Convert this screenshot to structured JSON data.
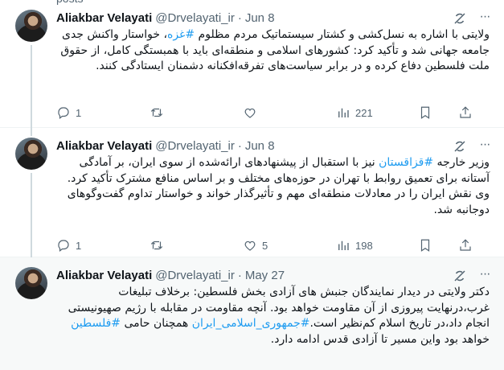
{
  "top_fragment": "posts",
  "tweets": [
    {
      "name": "Aliakbar Velayati",
      "handle": "@Drvelayati_ir",
      "dot": "·",
      "date": "Jun 8",
      "text_parts": [
        "ولایتی با اشاره به نسل‌کشی و کشتار سیستماتیک مردم مظلوم ",
        "#غزه",
        "، خواستار واکنش جدی جامعه جهانی شد و تأکید کرد: کشورهای اسلامی و منطقه‌ای باید با همبستگی کامل، از حقوق ملت فلسطین دفاع کرده و در برابر سیاست‌های تفرقه‌افکنانه دشمنان ایستادگی کنند."
      ],
      "replies": "1",
      "retweets": "",
      "likes": "",
      "views": "221"
    },
    {
      "name": "Aliakbar Velayati",
      "handle": "@Drvelayati_ir",
      "dot": "·",
      "date": "Jun 8",
      "text_parts": [
        "وزیر خارجه ",
        "#قزاقستان",
        " نیز با استقبال از پیشنهادهای ارائه‌شده از سوی ایران، بر آمادگی آستانه برای تعمیق روابط با تهران در حوزه‌های مختلف و بر اساس منافع مشترک تأکید کرد. وی نقش ایران را در معادلات منطقه‌ای مهم و تأثیرگذار خواند و خواستار تداوم گفت‌وگوهای دوجانبه شد."
      ],
      "replies": "1",
      "retweets": "",
      "likes": "5",
      "views": "198"
    },
    {
      "name": "Aliakbar Velayati",
      "handle": "@Drvelayati_ir",
      "dot": "·",
      "date": "May 27",
      "text_parts": [
        "دکتر ولایتی در دیدار نمایندگان جنبش های آزادی بخش فلسطین: برخلاف تبلیغات غرب،درنهایت پیروزی از آن مقاومت خواهد بود. آنچه مقاومت در مقابله با رژیم صهیونیستی انجام داد،در تاریخ اسلام کم‌نظیر است.",
        "#جمهوری_اسلامی_ایران",
        " همچنان حامی ",
        "#فلسطین",
        " خواهد بود واین مسیر تا آزادی قدس ادامه دارد."
      ]
    }
  ],
  "icons": {
    "reply": "reply-icon",
    "retweet": "retweet-icon",
    "like": "heart-icon",
    "views": "views-icon",
    "bookmark": "bookmark-icon",
    "share": "share-icon",
    "grok": "grok-icon",
    "more": "more-icon"
  },
  "colors": {
    "link": "#1d9bf0",
    "muted": "#536471",
    "text": "#0f1419"
  }
}
